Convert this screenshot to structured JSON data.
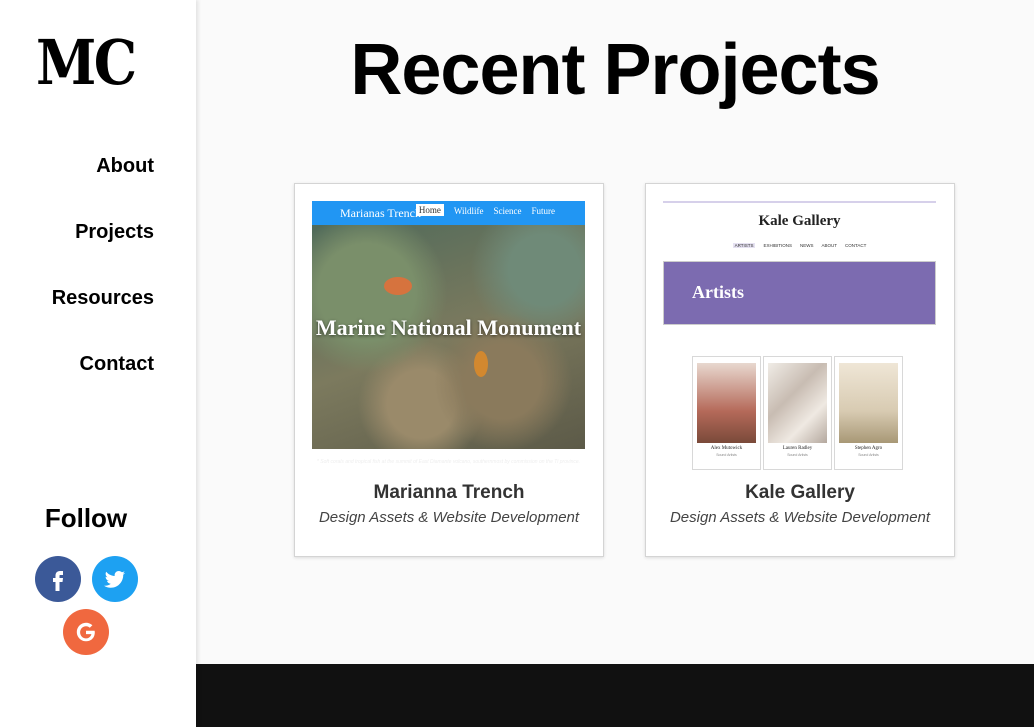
{
  "sidebar": {
    "logo": "MC",
    "nav": [
      "About",
      "Projects",
      "Resources",
      "Contact"
    ],
    "follow_label": "Follow",
    "social": [
      "facebook-icon",
      "twitter-icon",
      "google-icon"
    ]
  },
  "main": {
    "title": "Recent Projects",
    "cards": [
      {
        "title": "Marianna Trench",
        "subtitle": "Design Assets & Website Development",
        "thumb": {
          "brand": "Marianas Trench",
          "nav": [
            "Home",
            "Wildlife",
            "Science",
            "Future"
          ],
          "active": "Home",
          "headline": "Marine National Monument",
          "caption": "* Soft corals and tropical fish at the summit of East Diamante volcano, southernmost by commission on the Ti province."
        }
      },
      {
        "title": "Kale Gallery",
        "subtitle": "Design Assets & Website Development",
        "thumb": {
          "brand": "Kale Gallery",
          "nav": [
            "ARTISTS",
            "EXHIBITIONS",
            "NEWS",
            "ABOUT",
            "CONTACT"
          ],
          "active": "ARTISTS",
          "banner": "Artists",
          "artists": [
            {
              "name": "Alex Mutowick",
              "meta": "Sound Artists"
            },
            {
              "name": "Lauren Radley",
              "meta": "Sound Artists"
            },
            {
              "name": "Stephen Agro",
              "meta": "Sound Artists"
            }
          ]
        }
      }
    ]
  },
  "colors": {
    "facebook": "#3b5998",
    "twitter": "#1da1f2",
    "google": "#f0683f",
    "footer": "#111111"
  }
}
